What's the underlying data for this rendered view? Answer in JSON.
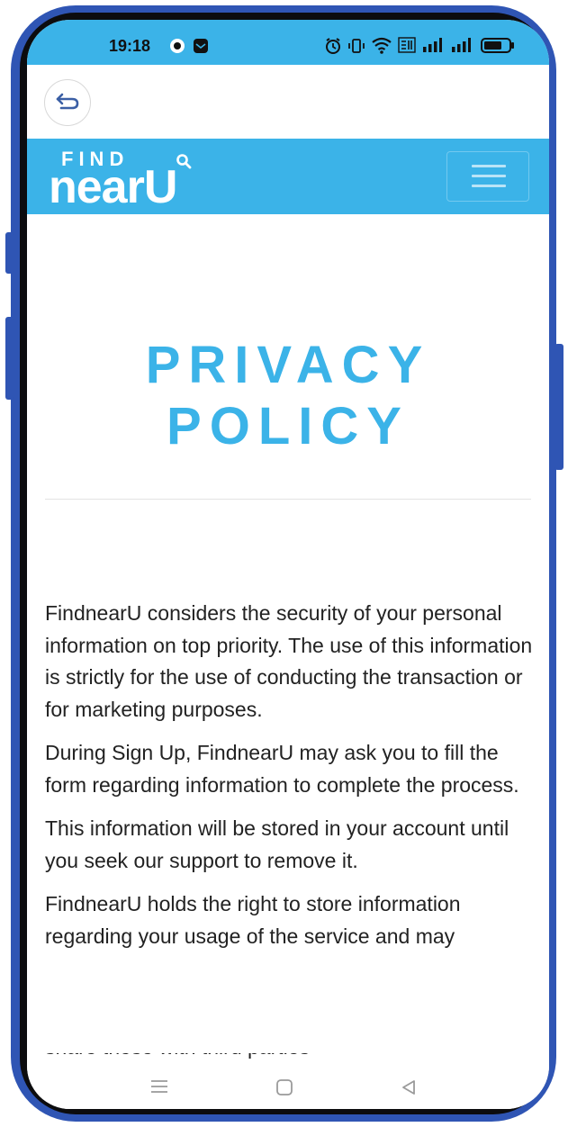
{
  "status_bar": {
    "time": "19:18",
    "icons": [
      "record-icon",
      "message-icon",
      "alarm-icon",
      "vibrate-icon",
      "wifi-icon",
      "volte-icon",
      "signal-icon",
      "signal-icon",
      "battery-icon"
    ]
  },
  "top_bar": {
    "back_icon": "back-arrow-icon"
  },
  "navbar": {
    "logo_top": "FIND",
    "logo_bottom": "nearU",
    "menu_icon": "hamburger-menu-icon",
    "background_color": "#3bb3e8"
  },
  "page": {
    "title_line1": "PRIVACY",
    "title_line2": "POLICY",
    "title_color": "#3bb3e8",
    "paragraphs": [
      "FindnearU considers the security of your personal information on top priority. The use of this information is strictly for the use of conducting the transaction or for marketing purposes.",
      "During Sign Up, FindnearU may ask you to fill the form regarding information to complete the process.",
      "This information will be stored in your account until you seek our support to remove it.",
      "FindnearU holds the right to store information regarding your usage of the service and may"
    ],
    "cut_line": "share those with third parties"
  },
  "system_nav": {
    "icons": [
      "menu-icon",
      "home-icon",
      "back-icon"
    ]
  }
}
